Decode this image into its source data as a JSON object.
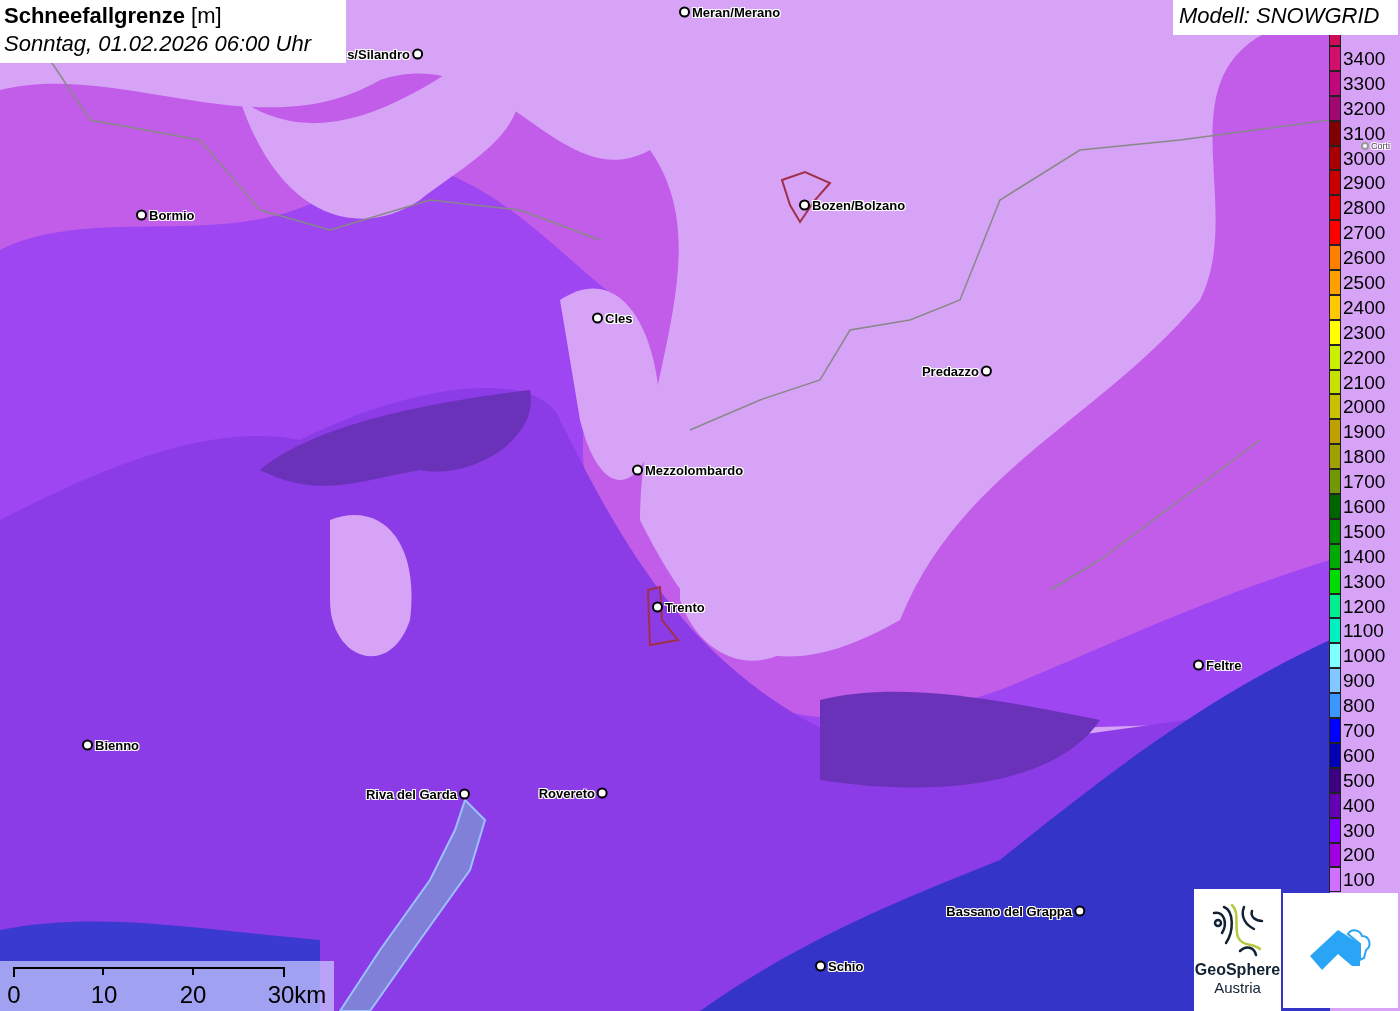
{
  "title": {
    "heading": "Schneefallgrenze",
    "unit": "[m]",
    "datetime": "Sonntag, 01.02.2026 06:00 Uhr"
  },
  "model": "Modell: SNOWGRID",
  "cities": [
    {
      "name": "Meran/Merano",
      "dimmed": false
    },
    {
      "name": "s/Silandro",
      "dimmed": false
    },
    {
      "name": "Bormio",
      "dimmed": false
    },
    {
      "name": "Bozen/Bolzano",
      "dimmed": false
    },
    {
      "name": "Cles",
      "dimmed": false
    },
    {
      "name": "Predazzo",
      "dimmed": false
    },
    {
      "name": "Mezzolombardo",
      "dimmed": false
    },
    {
      "name": "Trento",
      "dimmed": false
    },
    {
      "name": "Feltre",
      "dimmed": false
    },
    {
      "name": "Bienno",
      "dimmed": false
    },
    {
      "name": "Riva del Garda",
      "dimmed": false
    },
    {
      "name": "Rovereto",
      "dimmed": false
    },
    {
      "name": "Bassano del Grappa",
      "dimmed": false
    },
    {
      "name": "Schio",
      "dimmed": false
    },
    {
      "name": "Corti",
      "dimmed": true
    }
  ],
  "legend": [
    {
      "label": "3400",
      "color": "#d0106a"
    },
    {
      "label": "3300",
      "color": "#c0087a"
    },
    {
      "label": "3200",
      "color": "#a00870"
    },
    {
      "label": "3100",
      "color": "#800000"
    },
    {
      "label": "3000",
      "color": "#a80000"
    },
    {
      "label": "2900",
      "color": "#c80000"
    },
    {
      "label": "2800",
      "color": "#e00000"
    },
    {
      "label": "2700",
      "color": "#ff0000"
    },
    {
      "label": "2600",
      "color": "#ff8000"
    },
    {
      "label": "2500",
      "color": "#ffa000"
    },
    {
      "label": "2400",
      "color": "#ffc800"
    },
    {
      "label": "2300",
      "color": "#ffff00"
    },
    {
      "label": "2200",
      "color": "#c8f000"
    },
    {
      "label": "2100",
      "color": "#c8e000"
    },
    {
      "label": "2000",
      "color": "#c8c000"
    },
    {
      "label": "1900",
      "color": "#c0a000"
    },
    {
      "label": "1800",
      "color": "#a0a000"
    },
    {
      "label": "1700",
      "color": "#709800"
    },
    {
      "label": "1600",
      "color": "#006400"
    },
    {
      "label": "1500",
      "color": "#008c00"
    },
    {
      "label": "1400",
      "color": "#00aa00"
    },
    {
      "label": "1300",
      "color": "#00dc00"
    },
    {
      "label": "1200",
      "color": "#00f090"
    },
    {
      "label": "1100",
      "color": "#00f0c0"
    },
    {
      "label": "1000",
      "color": "#80ffff"
    },
    {
      "label": "900",
      "color": "#80c8ff"
    },
    {
      "label": "800",
      "color": "#3c96ff"
    },
    {
      "label": "700",
      "color": "#0000ff"
    },
    {
      "label": "600",
      "color": "#0000b4"
    },
    {
      "label": "500",
      "color": "#3c0080"
    },
    {
      "label": "400",
      "color": "#6400b4"
    },
    {
      "label": "300",
      "color": "#8000ff"
    },
    {
      "label": "200",
      "color": "#a000e0"
    },
    {
      "label": "100",
      "color": "#d070ff"
    }
  ],
  "scale": [
    "0",
    "10",
    "20",
    "30km"
  ],
  "logo": {
    "name": "GeoSphere",
    "country": "Austria"
  }
}
